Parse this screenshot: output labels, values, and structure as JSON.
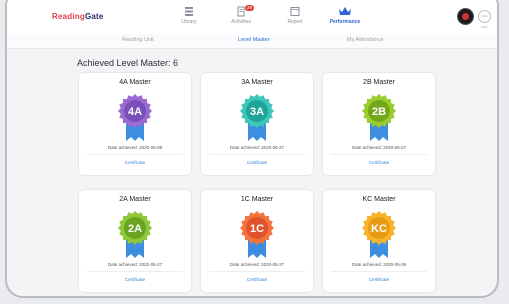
{
  "header": {
    "logo_left": "Reading",
    "logo_right": "Gate",
    "nav": [
      {
        "label": "Library",
        "icon": "library-icon"
      },
      {
        "label": "Activities",
        "icon": "activities-icon",
        "badge": "29"
      },
      {
        "label": "Report",
        "icon": "report-icon"
      },
      {
        "label": "Performance",
        "icon": "crown-icon",
        "active": true
      }
    ],
    "logout_label": "LOG OUT"
  },
  "subnav": {
    "tabs": [
      "Reading Unit",
      "Level Master",
      "My Attendance"
    ],
    "active": "Level Master"
  },
  "main": {
    "title": "Achieved Level Master:  6",
    "cards": [
      {
        "title": "4A Master",
        "badge": "4A",
        "date": "Date achieved: 2020-06-09",
        "cert": "Certificate",
        "color": "#9b6bd1",
        "ring": "#7b4fb8"
      },
      {
        "title": "3A Master",
        "badge": "3A",
        "date": "Date achieved: 2020-05-27",
        "cert": "Certificate",
        "color": "#3ec6b8",
        "ring": "#1fa597"
      },
      {
        "title": "2B Master",
        "badge": "2B",
        "date": "Date achieved: 2020-05-27",
        "cert": "Certificate",
        "color": "#9bcd2e",
        "ring": "#74a81a"
      },
      {
        "title": "2A Master",
        "badge": "2A",
        "date": "Date achieved: 2020-05-27",
        "cert": "Certificate",
        "color": "#8fc63a",
        "ring": "#6aa322"
      },
      {
        "title": "1C Master",
        "badge": "1C",
        "date": "Date achieved: 2020-05-27",
        "cert": "Certificate",
        "color": "#f4743f",
        "ring": "#e0522a"
      },
      {
        "title": "KC Master",
        "badge": "KC",
        "date": "Date achieved: 2020-05-26",
        "cert": "Certificate",
        "color": "#f7b32b",
        "ring": "#e89a12"
      }
    ],
    "ribbon_color": "#3d8de0"
  }
}
